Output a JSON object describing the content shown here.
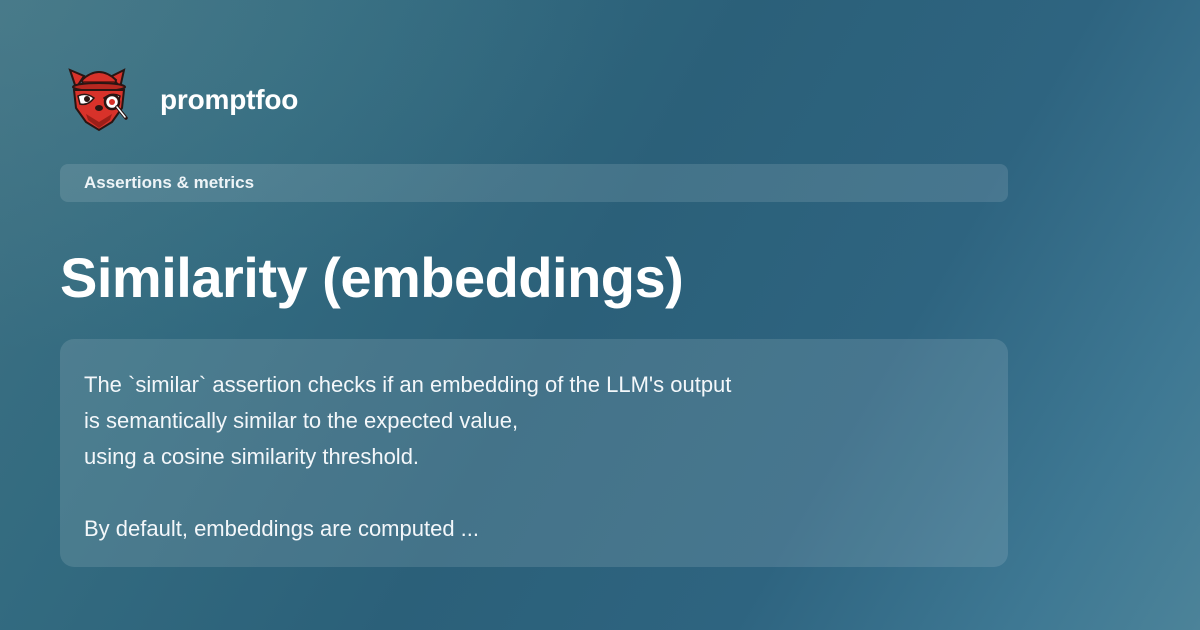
{
  "brand": {
    "name": "promptfoo",
    "logo_icon": "red-panda-detective-icon",
    "colors": {
      "logo_red": "#d8322a",
      "logo_dark": "#2a1513"
    }
  },
  "category": {
    "label": "Assertions & metrics"
  },
  "page": {
    "title": "Similarity (embeddings)",
    "description_lines": [
      "The `similar` assertion checks if an embedding of the LLM's output",
      "is semantically similar to the expected value,",
      "using a cosine similarity threshold.",
      "",
      "By default, embeddings are computed ..."
    ]
  }
}
